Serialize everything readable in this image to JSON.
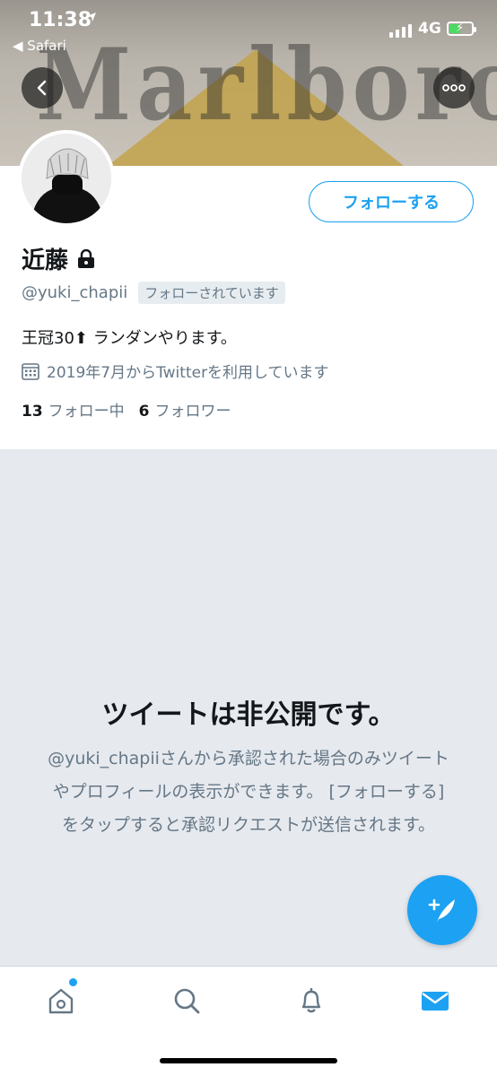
{
  "status_bar": {
    "time": "11:38",
    "back_app": "◀ Safari",
    "network": "4G"
  },
  "banner": {
    "text": "Marlboro"
  },
  "profile": {
    "display_name": "近藤",
    "handle": "@yuki_chapii",
    "follows_you": "フォローされています",
    "bio": "王冠30⬆ ランダンやります。",
    "joined": "2019年7月からTwitterを利用しています",
    "following_count": "13",
    "following_label": "フォロー中",
    "followers_count": "6",
    "followers_label": "フォロワー",
    "follow_button": "フォローする"
  },
  "protected": {
    "title": "ツイートは非公開です。",
    "body": "@yuki_chapiiさんから承認された場合のみツイートやプロフィールの表示ができます。 [フォローする] をタップすると承認リクエストが送信されます。"
  },
  "tabbar": {
    "items": [
      "home-icon",
      "search-icon",
      "bell-icon",
      "mail-icon"
    ],
    "active": "mail-icon",
    "badge_on": "home-icon"
  },
  "colors": {
    "accent": "#1da1f2",
    "muted": "#657786",
    "background": "#e6e9ee"
  }
}
